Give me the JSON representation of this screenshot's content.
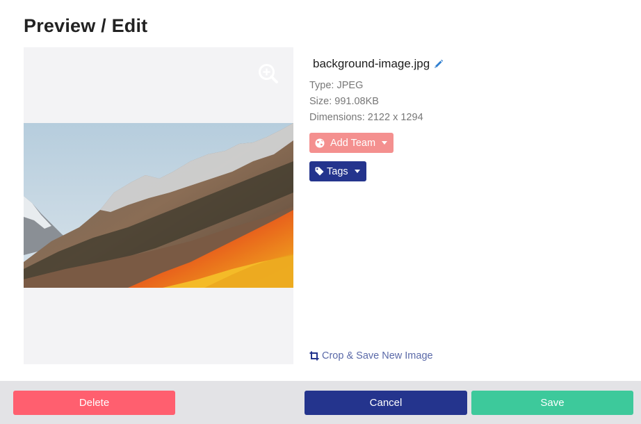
{
  "modal": {
    "title": "Preview / Edit"
  },
  "preview": {
    "zoom_icon": "zoom-in-icon",
    "image_alt": "mountain-landscape-photo"
  },
  "file": {
    "name": "background-image.jpg",
    "edit_icon": "pencil-icon",
    "type": "Type: JPEG",
    "size": "Size: 991.08KB",
    "dimensions": "Dimensions: 2122 x 1294"
  },
  "actions": {
    "team_label": "Add Team",
    "team_icon": "globe-icon",
    "tags_label": "Tags",
    "tags_icon": "tag-icon",
    "crop_label": "Crop & Save New Image",
    "crop_icon": "crop-icon"
  },
  "footer": {
    "delete_label": "Delete",
    "cancel_label": "Cancel",
    "save_label": "Save"
  },
  "colors": {
    "team_button": "#f4908f",
    "tags_button": "#24348d",
    "delete_button": "#ff5f6f",
    "cancel_button": "#24348d",
    "save_button": "#3dc99b",
    "link": "#5a69a8"
  }
}
